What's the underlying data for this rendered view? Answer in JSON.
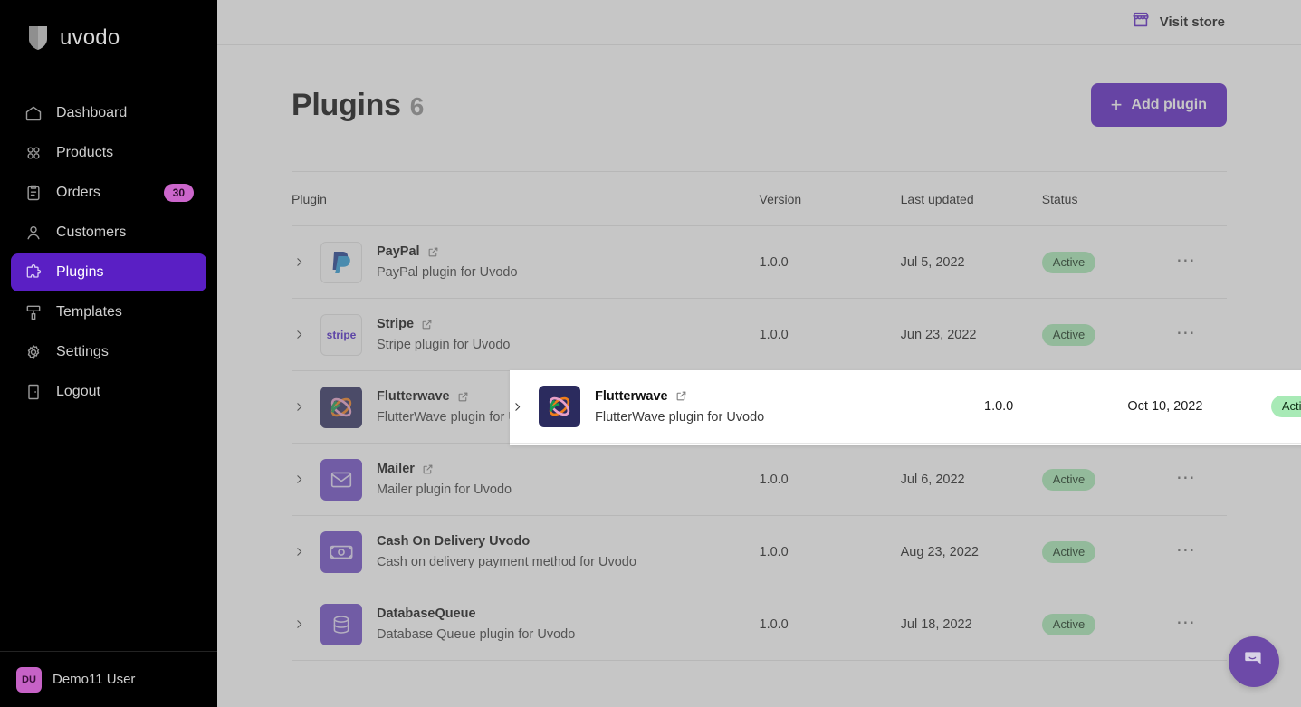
{
  "brand": {
    "name": "uvodo",
    "logo_icon": "shield-logo-icon"
  },
  "sidebar": {
    "items": [
      {
        "label": "Dashboard",
        "icon": "home-icon",
        "active": false
      },
      {
        "label": "Products",
        "icon": "grid-dots-icon",
        "active": false
      },
      {
        "label": "Orders",
        "icon": "clipboard-icon",
        "active": false,
        "badge": "30"
      },
      {
        "label": "Customers",
        "icon": "user-icon",
        "active": false
      },
      {
        "label": "Plugins",
        "icon": "puzzle-icon",
        "active": true
      },
      {
        "label": "Templates",
        "icon": "paint-roller-icon",
        "active": false
      },
      {
        "label": "Settings",
        "icon": "gear-icon",
        "active": false
      },
      {
        "label": "Logout",
        "icon": "door-exit-icon",
        "active": false
      }
    ],
    "user": {
      "initials": "DU",
      "name": "Demo11 User"
    }
  },
  "topbar": {
    "visit_store_label": "Visit store",
    "visit_store_icon": "storefront-icon"
  },
  "page": {
    "title": "Plugins",
    "count": "6",
    "add_button_label": "Add plugin",
    "add_button_icon": "plus-icon"
  },
  "table": {
    "columns": [
      "Plugin",
      "Version",
      "Last updated",
      "Status",
      ""
    ],
    "rows": [
      {
        "name": "PayPal",
        "description": "PayPal plugin for Uvodo",
        "version": "1.0.0",
        "last_updated": "Jul 5, 2022",
        "status": "Active",
        "logo": "paypal-logo",
        "has_external_link": true
      },
      {
        "name": "Stripe",
        "description": "Stripe plugin for Uvodo",
        "version": "1.0.0",
        "last_updated": "Jun 23, 2022",
        "status": "Active",
        "logo": "stripe-logo",
        "has_external_link": true
      },
      {
        "name": "Flutterwave",
        "description": "FlutterWave plugin for Uvodo",
        "version": "1.0.0",
        "last_updated": "Oct 10, 2022",
        "status": "Active",
        "logo": "flutterwave-logo",
        "has_external_link": true,
        "highlighted": true
      },
      {
        "name": "Mailer",
        "description": "Mailer plugin for Uvodo",
        "version": "1.0.0",
        "last_updated": "Jul 6, 2022",
        "status": "Active",
        "logo": "envelope-logo",
        "has_external_link": true
      },
      {
        "name": "Cash On Delivery Uvodo",
        "description": "Cash on delivery payment method for Uvodo",
        "version": "1.0.0",
        "last_updated": "Aug 23, 2022",
        "status": "Active",
        "logo": "banknote-logo",
        "has_external_link": false
      },
      {
        "name": "DatabaseQueue",
        "description": "Database Queue plugin for Uvodo",
        "version": "1.0.0",
        "last_updated": "Jul 18, 2022",
        "status": "Active",
        "logo": "database-logo",
        "has_external_link": false
      }
    ],
    "row_menu_icon": "ellipsis-icon",
    "row_expand_icon": "chevron-right-icon"
  },
  "chat": {
    "icon": "chat-bubble-icon"
  },
  "colors": {
    "accent": "#5a1fc4",
    "sidebar_bg": "#000000",
    "badge_active_bg": "#a8eab6",
    "orders_badge_bg": "#cc66cc",
    "overlay": "#b0b0b0"
  }
}
